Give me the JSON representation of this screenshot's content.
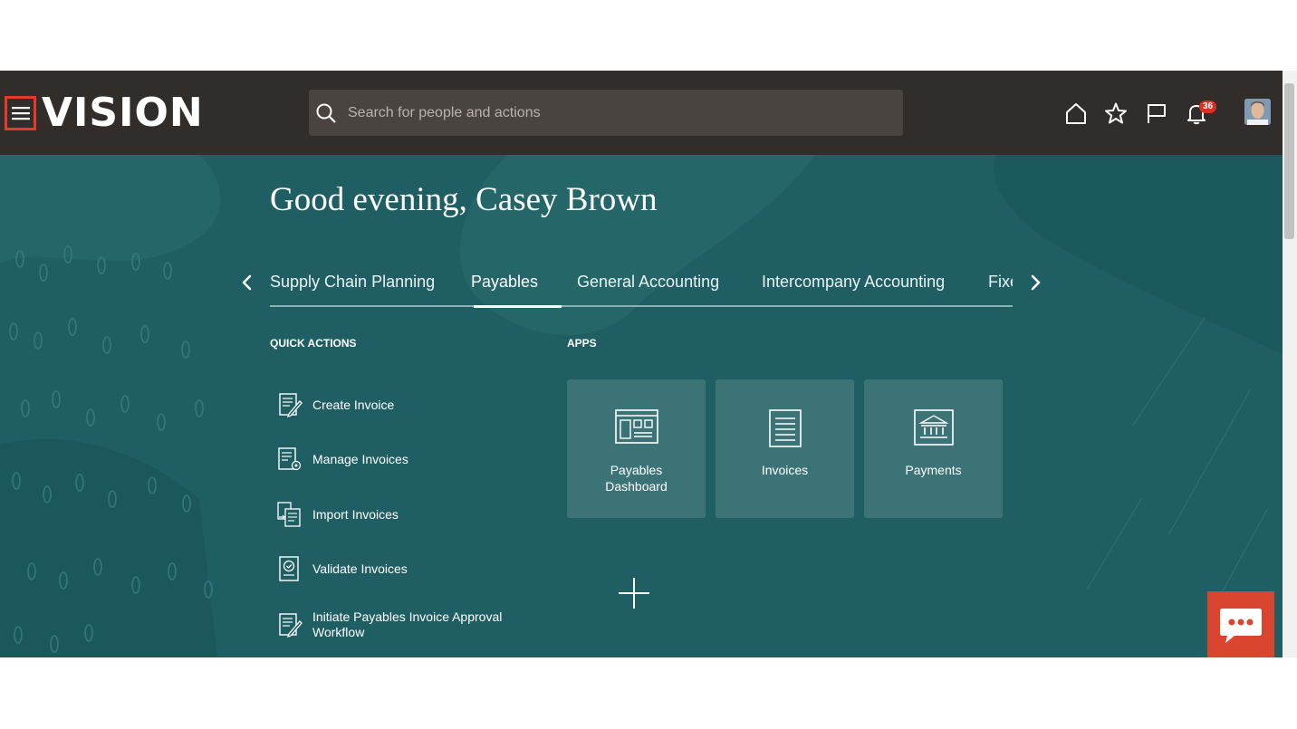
{
  "header": {
    "logo_text": "VISION",
    "search_placeholder": "Search for people and actions",
    "notification_count": "36",
    "icons": [
      "menu-icon",
      "search-icon",
      "home-icon",
      "star-icon",
      "flag-icon",
      "bell-icon",
      "avatar"
    ]
  },
  "greeting": "Good evening, Casey Brown",
  "tabs": [
    {
      "label": "Supply Chain Planning",
      "active": false
    },
    {
      "label": "Payables",
      "active": true
    },
    {
      "label": "General Accounting",
      "active": false
    },
    {
      "label": "Intercompany Accounting",
      "active": false
    },
    {
      "label": "Fixe",
      "active": false
    }
  ],
  "quick_actions": {
    "heading": "QUICK ACTIONS",
    "items": [
      {
        "label": "Create Invoice",
        "icon": "create-invoice-icon"
      },
      {
        "label": "Manage Invoices",
        "icon": "manage-invoices-icon"
      },
      {
        "label": "Import Invoices",
        "icon": "import-invoices-icon"
      },
      {
        "label": "Validate Invoices",
        "icon": "validate-invoices-icon"
      },
      {
        "label": "Initiate Payables Invoice Approval Workflow",
        "icon": "approval-workflow-icon"
      }
    ]
  },
  "apps": {
    "heading": "APPS",
    "tiles": [
      {
        "label": "Payables Dashboard",
        "icon": "dashboard-icon"
      },
      {
        "label": "Invoices",
        "icon": "document-icon"
      },
      {
        "label": "Payments",
        "icon": "bank-icon"
      }
    ]
  },
  "colors": {
    "topbar": "#312d2a",
    "hero": "#1f5f63",
    "accent_red": "#d9452f"
  }
}
